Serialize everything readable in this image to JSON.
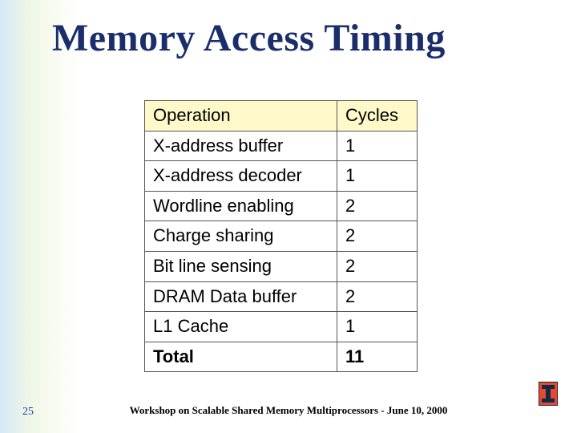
{
  "title": "Memory Access Timing",
  "table": {
    "headers": {
      "operation": "Operation",
      "cycles": "Cycles"
    },
    "rows": [
      {
        "op": "X-address buffer",
        "cy": "1"
      },
      {
        "op": "X-address decoder",
        "cy": "1"
      },
      {
        "op": "Wordline enabling",
        "cy": "2"
      },
      {
        "op": "Charge sharing",
        "cy": "2"
      },
      {
        "op": "Bit line sensing",
        "cy": "2"
      },
      {
        "op": "DRAM Data buffer",
        "cy": "2"
      },
      {
        "op": "L1 Cache",
        "cy": "1"
      }
    ],
    "total": {
      "op": "Total",
      "cy": "11"
    }
  },
  "footer": {
    "page": "25",
    "text": "Workshop on Scalable Shared Memory Multiprocessors - June 10, 2000"
  },
  "chart_data": {
    "type": "table",
    "title": "Memory Access Timing",
    "columns": [
      "Operation",
      "Cycles"
    ],
    "rows": [
      [
        "X-address buffer",
        1
      ],
      [
        "X-address decoder",
        1
      ],
      [
        "Wordline enabling",
        2
      ],
      [
        "Charge sharing",
        2
      ],
      [
        "Bit line sensing",
        2
      ],
      [
        "DRAM Data buffer",
        2
      ],
      [
        "L1 Cache",
        1
      ],
      [
        "Total",
        11
      ]
    ]
  }
}
